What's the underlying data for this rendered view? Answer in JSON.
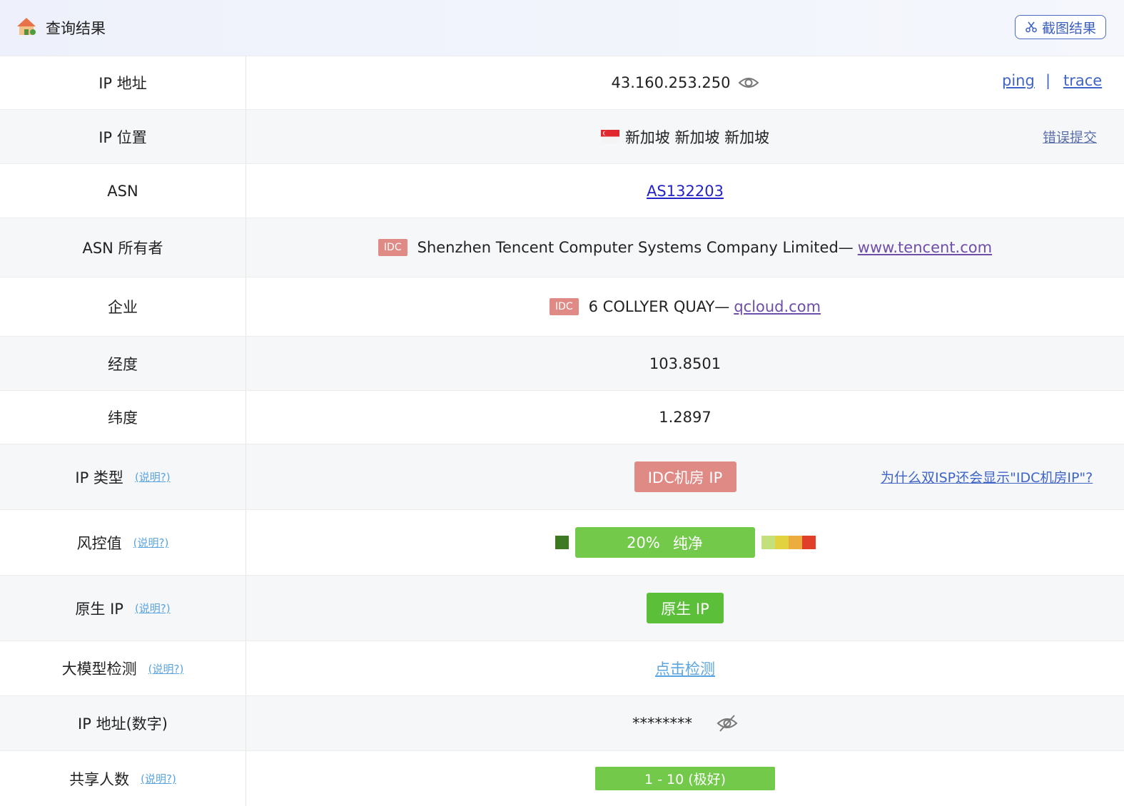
{
  "header": {
    "title": "查询结果",
    "logo_icon": "house-icon",
    "screenshot_button": "截图结果",
    "screenshot_icon": "scissors-icon"
  },
  "rows": {
    "ip": {
      "label": "IP 地址",
      "value": "43.160.253.250",
      "ping": "ping",
      "separator": "|",
      "trace": "trace"
    },
    "location": {
      "label": "IP 位置",
      "value": "新加坡 新加坡 新加坡",
      "flag_icon": "singapore-flag-icon",
      "report": "错误提交"
    },
    "asn": {
      "label": "ASN",
      "value": "AS132203"
    },
    "asn_owner": {
      "label": "ASN 所有者",
      "tag": "IDC",
      "value": "Shenzhen Tencent Computer Systems Company Limited—",
      "link": "www.tencent.com"
    },
    "company": {
      "label": "企业",
      "tag": "IDC",
      "value": "6 COLLYER QUAY—",
      "link": "qcloud.com"
    },
    "longitude": {
      "label": "经度",
      "value": "103.8501"
    },
    "latitude": {
      "label": "纬度",
      "value": "1.2897"
    },
    "ip_type": {
      "label": "IP 类型",
      "help": "(说明?)",
      "badge": "IDC机房 IP",
      "why_link": "为什么双ISP还会显示\"IDC机房IP\"?"
    },
    "risk": {
      "label": "风控值",
      "help": "(说明?)",
      "percent": "20%",
      "level": "纯净",
      "score_fraction": 0.2
    },
    "native": {
      "label": "原生 IP",
      "help": "(说明?)",
      "badge": "原生 IP"
    },
    "llm": {
      "label": "大模型检测",
      "help": "(说明?)",
      "link": "点击检测"
    },
    "ip_number": {
      "label": "IP 地址(数字)",
      "value": "********"
    },
    "shared": {
      "label": "共享人数",
      "help": "(说明?)",
      "value": "1 - 10 (极好)"
    }
  },
  "colors": {
    "idc_red": "#e08a86",
    "green": "#72c94a",
    "risk_scale": [
      "#c3e07a",
      "#e3d23f",
      "#ecad3f",
      "#e0402a"
    ]
  }
}
